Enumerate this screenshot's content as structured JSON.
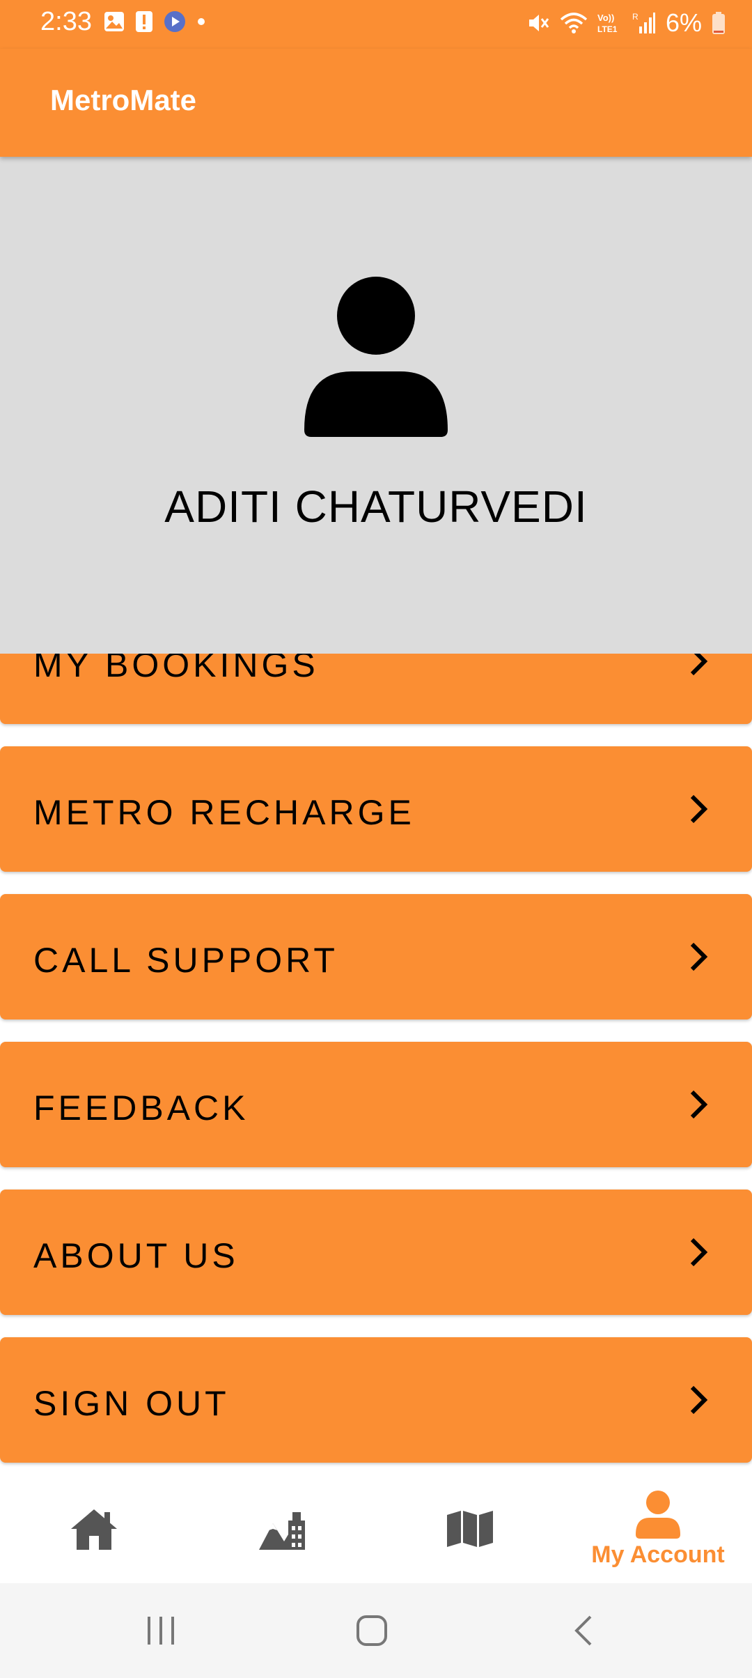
{
  "status_bar": {
    "time": "2:33",
    "battery": "6%",
    "icons": [
      "image-icon",
      "alert-icon",
      "app-icon",
      "dot-icon",
      "mute-icon",
      "wifi-icon",
      "volte-icon",
      "signal-icon",
      "battery-icon"
    ]
  },
  "app_bar": {
    "title": "MetroMate"
  },
  "profile": {
    "name": "ADITI CHATURVEDI",
    "avatar_icon": "person-icon"
  },
  "menu": [
    {
      "label": "MY BOOKINGS"
    },
    {
      "label": "METRO RECHARGE"
    },
    {
      "label": "CALL SUPPORT"
    },
    {
      "label": "FEEDBACK"
    },
    {
      "label": "ABOUT US"
    },
    {
      "label": "SIGN OUT"
    }
  ],
  "bottom_nav": {
    "items": [
      {
        "icon": "home-icon",
        "label": ""
      },
      {
        "icon": "city-icon",
        "label": ""
      },
      {
        "icon": "map-icon",
        "label": ""
      },
      {
        "icon": "account-icon",
        "label": "My Account",
        "active": true
      }
    ]
  },
  "system_nav": [
    "recents-button",
    "home-button",
    "back-button"
  ],
  "colors": {
    "accent": "#fb8e33",
    "profile_bg": "#dcdcdc",
    "inactive_icon": "#555555"
  }
}
